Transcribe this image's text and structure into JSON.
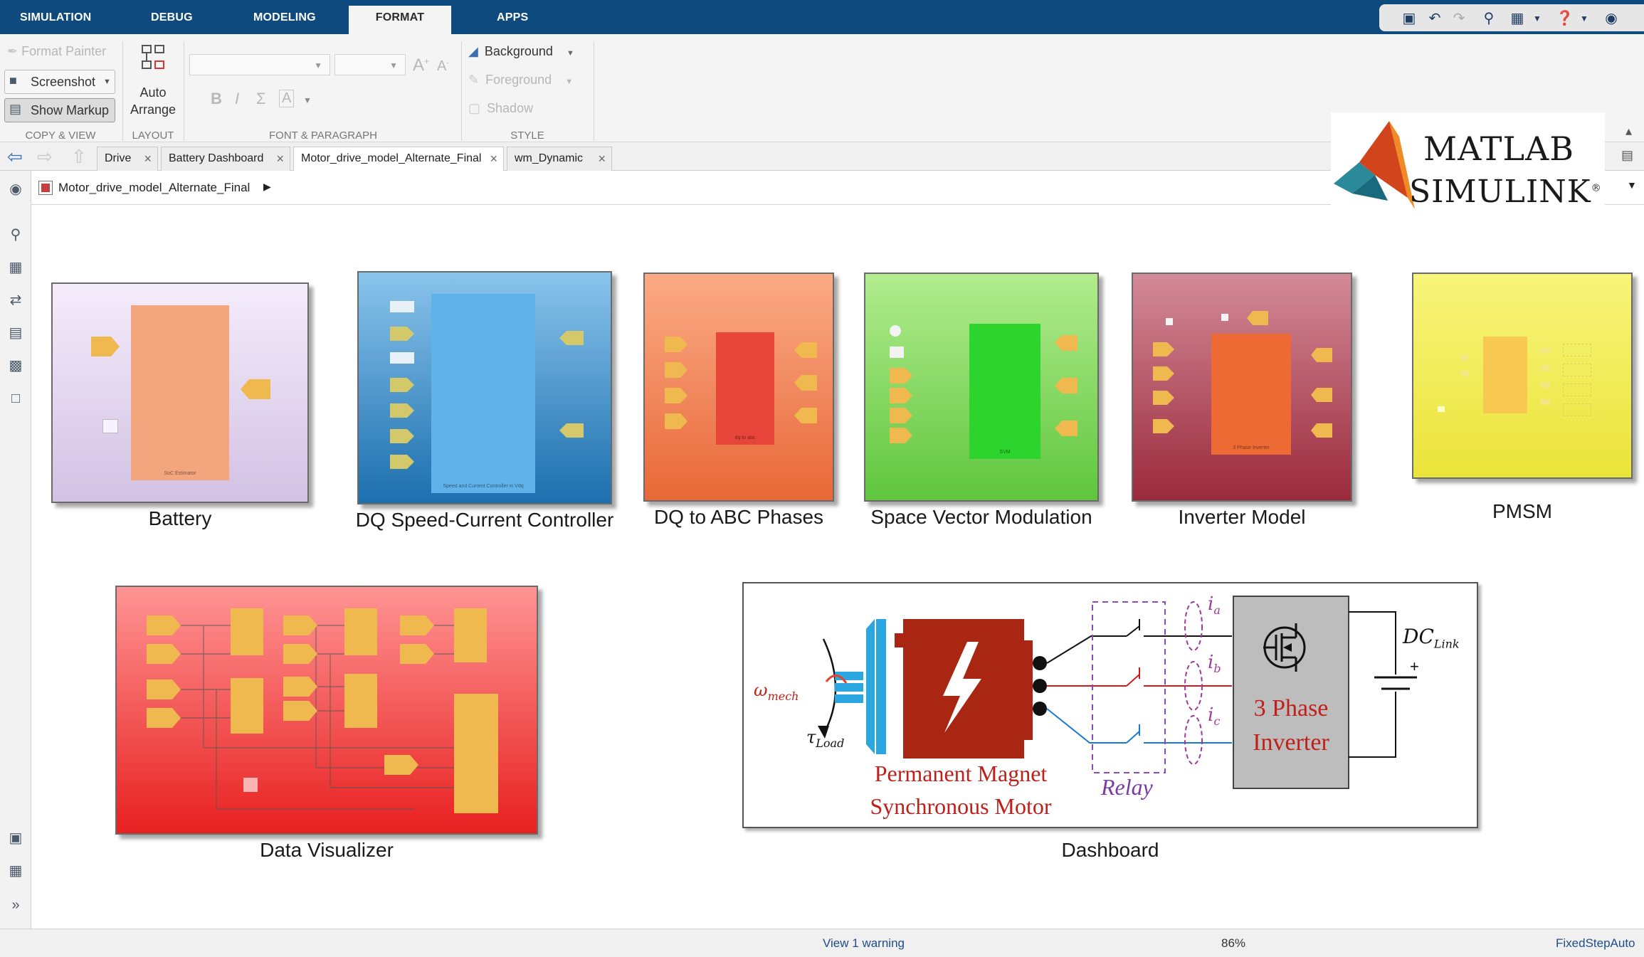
{
  "menu": {
    "tabs": [
      {
        "label": "SIMULATION"
      },
      {
        "label": "DEBUG"
      },
      {
        "label": "MODELING"
      },
      {
        "label": "FORMAT"
      },
      {
        "label": "APPS"
      }
    ],
    "active_tab": "FORMAT"
  },
  "ribbon": {
    "format_painter": "Format Painter",
    "screenshot": "Screenshot",
    "show_markup": "Show Markup",
    "copy_view_group": "COPY & VIEW",
    "auto": "Auto",
    "arrange": "Arrange",
    "layout_group": "LAYOUT",
    "font_paragraph_group": "FONT & PARAGRAPH",
    "bold": "B",
    "italic": "I",
    "sigma": "Σ",
    "font_a": "A",
    "background": "Background",
    "foreground": "Foreground",
    "shadow": "Shadow",
    "style_group": "STYLE"
  },
  "tabs": [
    {
      "label": "Drive"
    },
    {
      "label": "Battery Dashboard"
    },
    {
      "label": "Motor_drive_model_Alternate_Final"
    },
    {
      "label": "wm_Dynamic"
    }
  ],
  "breadcrumb": {
    "model": "Motor_drive_model_Alternate_Final"
  },
  "blocks": {
    "battery": {
      "label": "Battery",
      "inner": "SoC Estimator"
    },
    "dq": {
      "label": "DQ Speed-Current Controller",
      "inner": "Speed and Current Controller in Vdq"
    },
    "dq_abc": {
      "label": "DQ to ABC Phases",
      "inner": "dq to abc"
    },
    "svm": {
      "label": "Space Vector Modulation",
      "inner": "SVM"
    },
    "inverter": {
      "label": "Inverter Model",
      "inner": "3 Phase Inverter"
    },
    "pmsm": {
      "label": "PMSM"
    },
    "visualizer": {
      "label": "Data Visualizer"
    },
    "dashboard": {
      "label": "Dashboard"
    }
  },
  "dashboard_image": {
    "omega": "ω",
    "omega_sub": "mech",
    "tau": "τ",
    "tau_sub": "Load",
    "pm_line1": "Permanent Magnet",
    "pm_line2": "Synchronous Motor",
    "relay": "Relay",
    "ia": "i",
    "ia_sub": "a",
    "ib": "i",
    "ib_sub": "b",
    "ic": "i",
    "ic_sub": "c",
    "inv_line1": "3 Phase",
    "inv_line2": "Inverter",
    "dc": "DC",
    "dc_sub": "Link",
    "plus": "+"
  },
  "status": {
    "warning": "View 1 warning",
    "zoom": "86%",
    "solver": "FixedStepAuto"
  },
  "logo": {
    "matlab": "MATLAB",
    "simulink": "SIMULINK",
    "reg": "®"
  },
  "colors": {
    "menubar": "#0e4a7e",
    "battery": "#e8dcf0",
    "dq": "#3a8fd0",
    "dq_abc": "#f0804f",
    "svm": "#7fd65b",
    "inverter": "#b04557",
    "pmsm": "#f2ef50",
    "visualizer": "#ef4545",
    "port": "#f0b94f"
  }
}
